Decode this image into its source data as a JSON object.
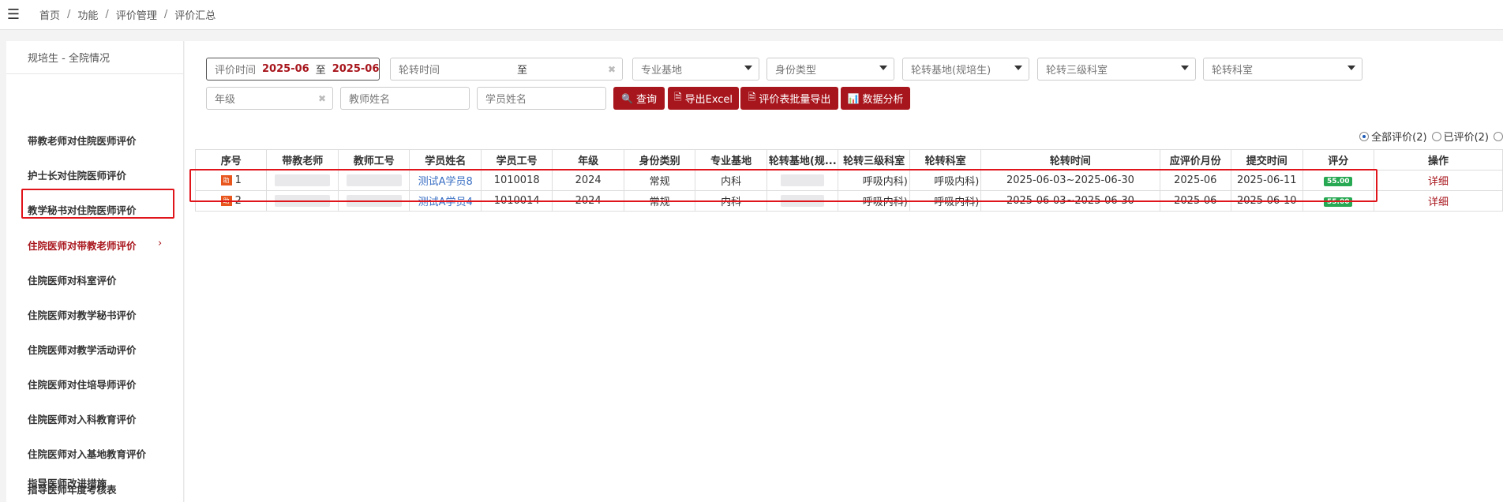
{
  "breadcrumb": [
    "首页",
    "功能",
    "评价管理",
    "评价汇总"
  ],
  "sidebar": {
    "header": "规培生 - 全院情况",
    "items": [
      {
        "label": "带教老师对住院医师评价"
      },
      {
        "label": "护士长对住院医师评价"
      },
      {
        "label": "教学秘书对住院医师评价"
      },
      {
        "label": "住院医师对带教老师评价",
        "active": true
      },
      {
        "label": "住院医师对科室评价"
      },
      {
        "label": "住院医师对教学秘书评价"
      },
      {
        "label": "住院医师对教学活动评价"
      },
      {
        "label": "住院医师对住培导师评价"
      },
      {
        "label": "住院医师对入科教育评价"
      },
      {
        "label": "住院医师对入基地教育评价"
      },
      {
        "label": "指导医师年度考核表"
      },
      {
        "label": "指导医师改进措施"
      }
    ],
    "chevron": "›"
  },
  "filters": {
    "eval_time_label": "评价时间",
    "eval_time_from": "2025-06",
    "eval_time_to_label": "至",
    "eval_time_to": "2025-06",
    "rotation_time_label": "轮转时间",
    "rotation_time_to_label": "至",
    "major_base": "专业基地",
    "identity_type": "身份类型",
    "rotation_base": "轮转基地(规培生)",
    "rotation_dept3": "轮转三级科室",
    "rotation_dept": "轮转科室",
    "grade_placeholder": "年级",
    "teacher_name_placeholder": "教师姓名",
    "student_name_placeholder": "学员姓名",
    "clear_glyph": "✖"
  },
  "buttons": {
    "query": "查询",
    "export_excel": "导出Excel",
    "batch_export": "评价表批量导出",
    "data_analysis": "数据分析"
  },
  "radios": [
    {
      "label": "全部评价(2)",
      "checked": true
    },
    {
      "label": "已评价(2)",
      "checked": false
    }
  ],
  "table": {
    "headers": [
      "序号",
      "带教老师",
      "教师工号",
      "学员姓名",
      "学员工号",
      "年级",
      "身份类别",
      "专业基地",
      "轮转基地(规...",
      "轮转三级科室",
      "轮转科室",
      "轮转时间",
      "应评价月份",
      "提交时间",
      "评分",
      "操作"
    ],
    "badge_text": "助",
    "rows": [
      {
        "no": "1",
        "student": "测试A学员8",
        "student_id": "1010018",
        "grade": "2024",
        "identity": "常规",
        "major": "内科",
        "dept3": "呼吸内科)",
        "dept": "呼吸内科)",
        "rotation_time": "2025-06-03~2025-06-30",
        "month": "2025-06",
        "submit": "2025-06-11",
        "score": "55.00",
        "action": "详细"
      },
      {
        "no": "2",
        "student": "测试A学员4",
        "student_id": "1010014",
        "grade": "2024",
        "identity": "常规",
        "major": "内科",
        "dept3": "呼吸内科)",
        "dept": "呼吸内科)",
        "rotation_time": "2025-06-03~2025-06-30",
        "month": "2025-06",
        "submit": "2025-06-10",
        "score": "55.00",
        "action": "详细"
      }
    ]
  },
  "colors": {
    "accent": "#a8161d",
    "highlight_border": "#e0141b",
    "link": "#3a6fc4",
    "score_badge": "#27a852"
  }
}
